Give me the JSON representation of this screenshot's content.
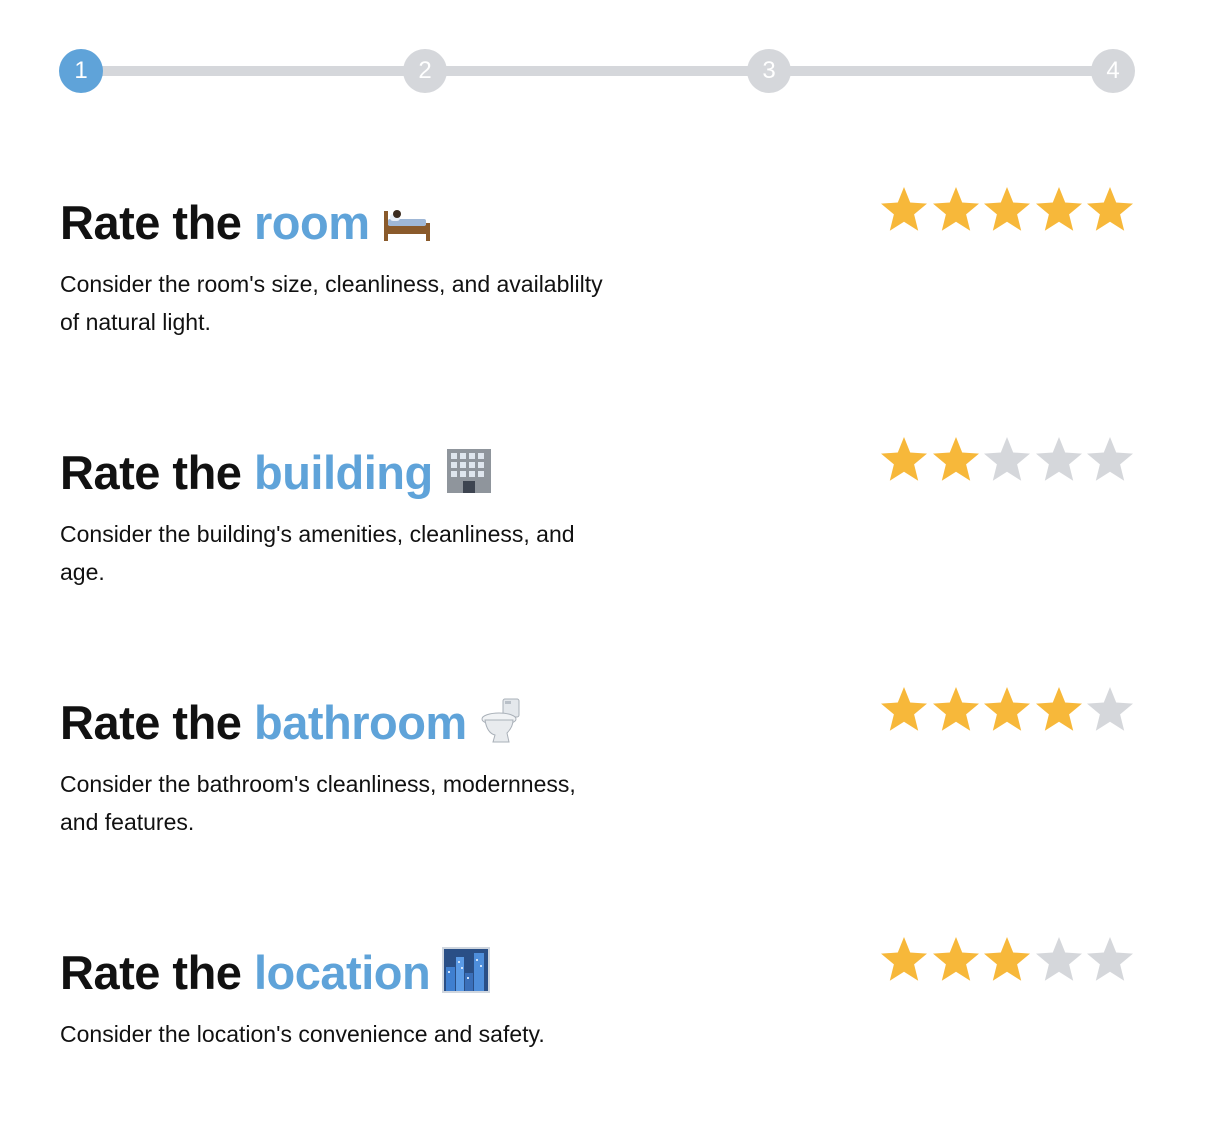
{
  "stepper": {
    "current": 1,
    "steps": [
      {
        "label": "1",
        "active": true
      },
      {
        "label": "2",
        "active": false
      },
      {
        "label": "3",
        "active": false
      },
      {
        "label": "4",
        "active": false
      }
    ]
  },
  "colors": {
    "accent": "#5fa3d9",
    "star_filled": "#f7b83a",
    "star_empty": "#d5d7db",
    "inactive": "#d5d7db"
  },
  "ratings": [
    {
      "prefix": "Rate the",
      "highlight": "room",
      "icon": "bed-icon",
      "description": "Consider the room's size, cleanliness, and availablilty of natural light.",
      "stars": 5,
      "max_stars": 5
    },
    {
      "prefix": "Rate the",
      "highlight": "building",
      "icon": "office-building-icon",
      "description": "Consider the building's amenities, cleanliness, and age.",
      "stars": 2,
      "max_stars": 5
    },
    {
      "prefix": "Rate the",
      "highlight": "bathroom",
      "icon": "toilet-icon",
      "description": "Consider the bathroom's cleanliness, modernness, and features.",
      "stars": 4,
      "max_stars": 5
    },
    {
      "prefix": "Rate the",
      "highlight": "location",
      "icon": "cityscape-icon",
      "description": "Consider the location's convenience and safety.",
      "stars": 3,
      "max_stars": 5
    }
  ]
}
